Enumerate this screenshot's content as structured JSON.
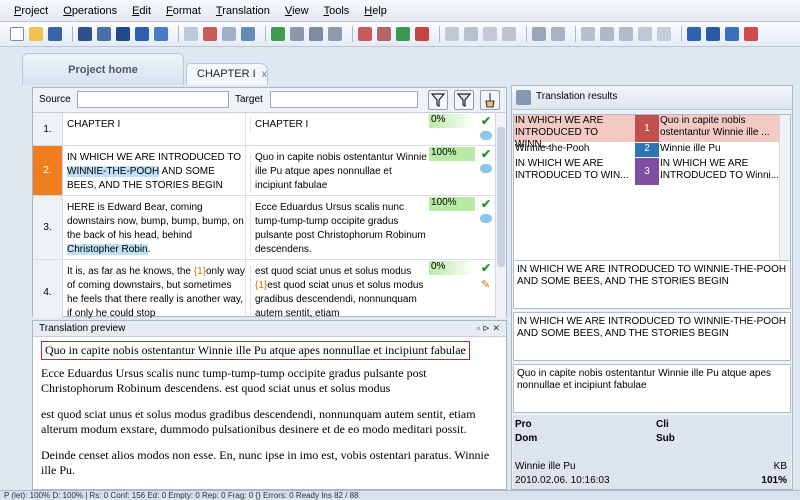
{
  "menu": [
    "Project",
    "Operations",
    "Edit",
    "Format",
    "Translation",
    "View",
    "Tools",
    "Help"
  ],
  "tabs": {
    "home": "Project home",
    "chapter": "CHAPTER I",
    "chapter_close": "x"
  },
  "filter": {
    "source_label": "Source",
    "target_label": "Target"
  },
  "rows": [
    {
      "num": "1.",
      "src": "CHAPTER I",
      "tgt": "CHAPTER I",
      "pct": "0%"
    },
    {
      "num": "2.",
      "src_pre": "IN WHICH WE ARE INTRODUCED TO ",
      "src_hl": "WINNIE-THE-POOH",
      "src_post": " AND SOME BEES, AND THE STORIES BEGIN",
      "tgt": "Quo in capite nobis ostentantur Winnie ille Pu atque apes nonnullae et incipiunt fabulae",
      "pct": "100%"
    },
    {
      "num": "3.",
      "src_pre": "HERE is Edward Bear, coming downstairs now, bump, bump, bump, on the back of his head, behind ",
      "src_hl": "Christopher Robin",
      "src_post": ".",
      "tgt": "Ecce Eduardus Ursus scalis nunc tump-tump-tump occipite gradus pulsante post Christophorum Robinum descendens.",
      "pct": "100%"
    },
    {
      "num": "4.",
      "src_pre": "It is, as far as he knows, the ",
      "src_tag": "{1}",
      "src_post": "only way of coming downstairs, but sometimes he feels that there really is another way, if only he could stop",
      "tgt_pre": "est quod sciat unus et solus modus ",
      "tgt_tag": "{1}",
      "tgt_post": "est quod sciat unus et solus modus gradibus descendendi, nonnunquam autem sentit, etiam",
      "pct": "0%"
    }
  ],
  "preview": {
    "title": "Translation preview",
    "first": "Quo in capite nobis ostentantur Winnie ille Pu atque apes nonnullae et incipiunt fabulae",
    "p2": "Ecce Eduardus Ursus scalis nunc tump-tump-tump occipite gradus pulsante post Christophorum Robinum descendens. est quod sciat unus et solus modus",
    "p3": "est quod sciat unus et solus modus gradibus descendendi, nonnunquam autem sentit, etiam alterum modum exstare, dummodo pulsationibus desinere et de eo modo meditari possit.",
    "p4": "Deinde censet alios modos non esse. En, nunc ipse in imo est, vobis ostentari paratus. Winnie ille Pu."
  },
  "results": {
    "title": "Translation results",
    "items": [
      {
        "src": "IN WHICH WE ARE INTRODUCED TO WINN...",
        "num": "1",
        "tgt": "Quo in capite nobis ostentantur Winnie ille ...",
        "color": "#c0504d"
      },
      {
        "src": "Winnie-the-Pooh",
        "num": "2",
        "tgt": "Winnie ille Pu",
        "color": "#2e75b6"
      },
      {
        "src": "IN WHICH WE ARE INTRODUCED TO WIN...",
        "num": "3",
        "tgt": "IN WHICH WE ARE INTRODUCED TO Winni...",
        "color": "#7d4f9e"
      }
    ],
    "compare1": "IN WHICH WE ARE INTRODUCED TO WINNIE-THE-POOH AND SOME BEES, AND THE STORIES BEGIN",
    "compare2": "IN WHICH WE ARE INTRODUCED TO WINNIE-THE-POOH AND SOME BEES, AND THE STORIES BEGIN",
    "compare3": "Quo in capite nobis ostentantur Winnie ille Pu atque apes nonnullae et incipiunt fabulae",
    "meta": {
      "pro": "Pro",
      "cli": "Cli",
      "dom": "Dom",
      "sub": "Sub",
      "user": "Winnie ille Pu",
      "kb": "KB",
      "date": "2010.02.06. 10:16:03",
      "pct": "101%"
    }
  },
  "status": "P (let): 100%   D: 100%   |   Rs: 0   Conf: 156   Ed: 0   Empty: 0   Rep: 0   Frag: 0   {} Errors: 0   Ready   Ins   82 / 88"
}
